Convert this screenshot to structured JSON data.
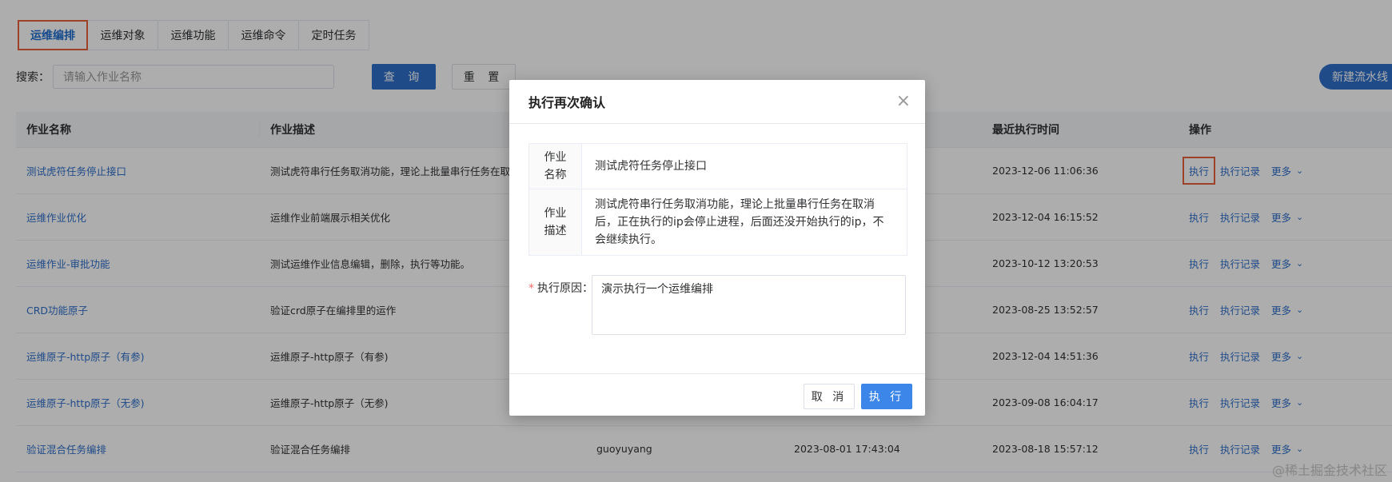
{
  "tabs": [
    {
      "label": "运维编排",
      "active": true
    },
    {
      "label": "运维对象"
    },
    {
      "label": "运维功能"
    },
    {
      "label": "运维命令"
    },
    {
      "label": "定时任务"
    }
  ],
  "search": {
    "label": "搜索：",
    "placeholder": "请输入作业名称",
    "query_label": "查 询",
    "reset_label": "重 置"
  },
  "new_pipeline_label": "新建流水线",
  "table": {
    "headers": [
      "作业名称",
      "作业描述",
      "",
      "",
      "最近执行时间",
      "操作"
    ],
    "rows": [
      {
        "name": "测试虎符任务停止接口",
        "desc": "测试虎符串行任务取消功能，理论上批量串行任务在取消",
        "creator": "",
        "created": "",
        "last": "2023-12-06 11:06:36"
      },
      {
        "name": "运维作业优化",
        "desc": "运维作业前端展示相关优化",
        "creator": "",
        "created": "",
        "last": "2023-12-04 16:15:52"
      },
      {
        "name": "运维作业-审批功能",
        "desc": "测试运维作业信息编辑，删除，执行等功能。",
        "creator": "",
        "created": "",
        "last": "2023-10-12 13:20:53"
      },
      {
        "name": "CRD功能原子",
        "desc": "验证crd原子在编排里的运作",
        "creator": "",
        "created": "",
        "last": "2023-08-25 13:52:57"
      },
      {
        "name": "运维原子-http原子（有参)",
        "desc": "运维原子-http原子（有参)",
        "creator": "",
        "created": "",
        "last": "2023-12-04 14:51:36"
      },
      {
        "name": "运维原子-http原子（无参)",
        "desc": "运维原子-http原子（无参)",
        "creator": "",
        "created": "",
        "last": "2023-09-08 16:04:17"
      },
      {
        "name": "验证混合任务编排",
        "desc": "验证混合任务编排",
        "creator": "guoyuyang",
        "created": "2023-08-01 17:43:04",
        "last": "2023-08-18 15:57:12"
      }
    ],
    "ops": {
      "exec": "执行",
      "records": "执行记录",
      "more": "更多"
    }
  },
  "modal": {
    "title": "执行再次确认",
    "job_name_key": "作业\n名称",
    "job_name_val": "测试虎符任务停止接口",
    "job_desc_key": "作业\n描述",
    "job_desc_val": "测试虎符串行任务取消功能，理论上批量串行任务在取消后，正在执行的ip会停止进程，后面还没开始执行的ip，不会继续执行。",
    "reason_label": "执行原因：",
    "reason_value": "演示执行一个运维编排",
    "cancel_label": "取 消",
    "exec_label": "执 行"
  },
  "watermark": "@稀土掘金技术社区"
}
